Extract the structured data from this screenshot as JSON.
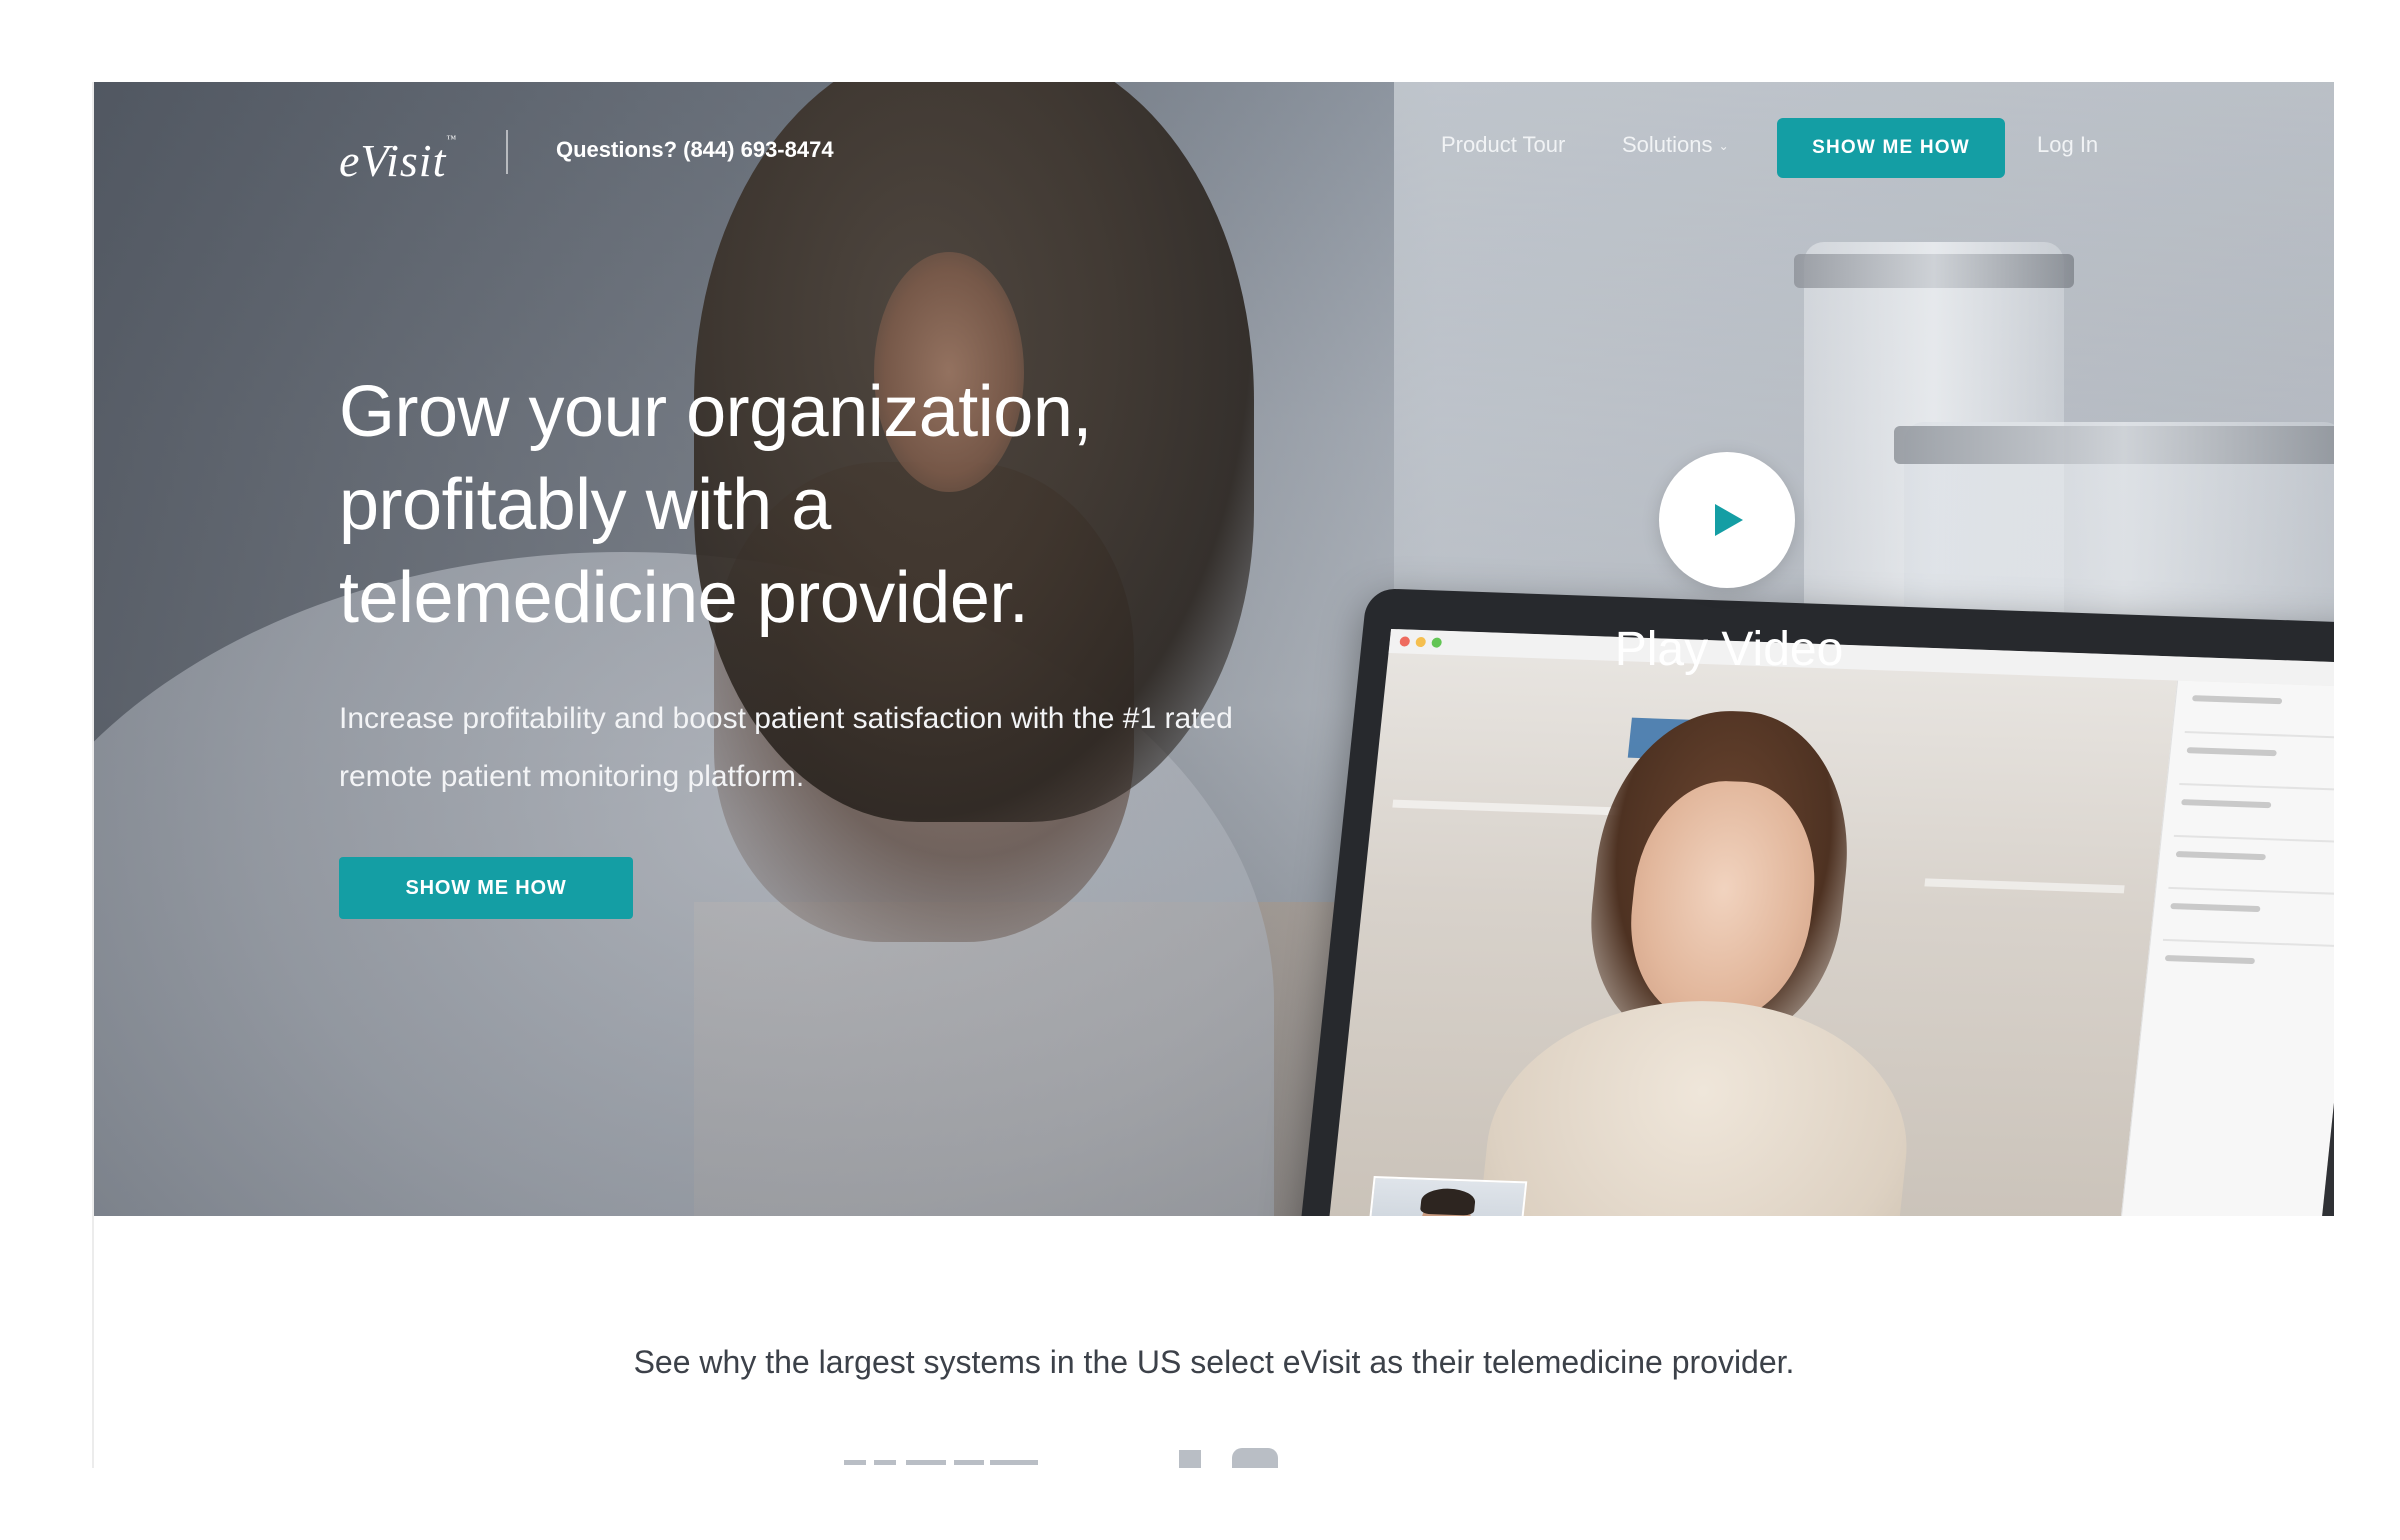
{
  "nav": {
    "logo_text": "eVisit",
    "logo_tm": "™",
    "phone": "Questions? (844) 693-8474",
    "product_tour": "Product Tour",
    "solutions": "Solutions",
    "cta": "SHOW ME HOW",
    "login": "Log In"
  },
  "hero": {
    "headline": "Grow your organization, profitably with a telemedicine provider.",
    "subtext": "Increase profitability and boost patient satisfaction with the #1 rated remote patient monitoring platform.",
    "cta": "SHOW ME HOW",
    "play_label": "Play Video"
  },
  "section": {
    "tagline": "See why the largest systems in the US select eVisit as their telemedicine provider."
  },
  "colors": {
    "accent": "#149ea4",
    "text_dark": "#3c4149"
  },
  "icons": {
    "play": "play-icon",
    "chevron": "chevron-down-icon"
  }
}
